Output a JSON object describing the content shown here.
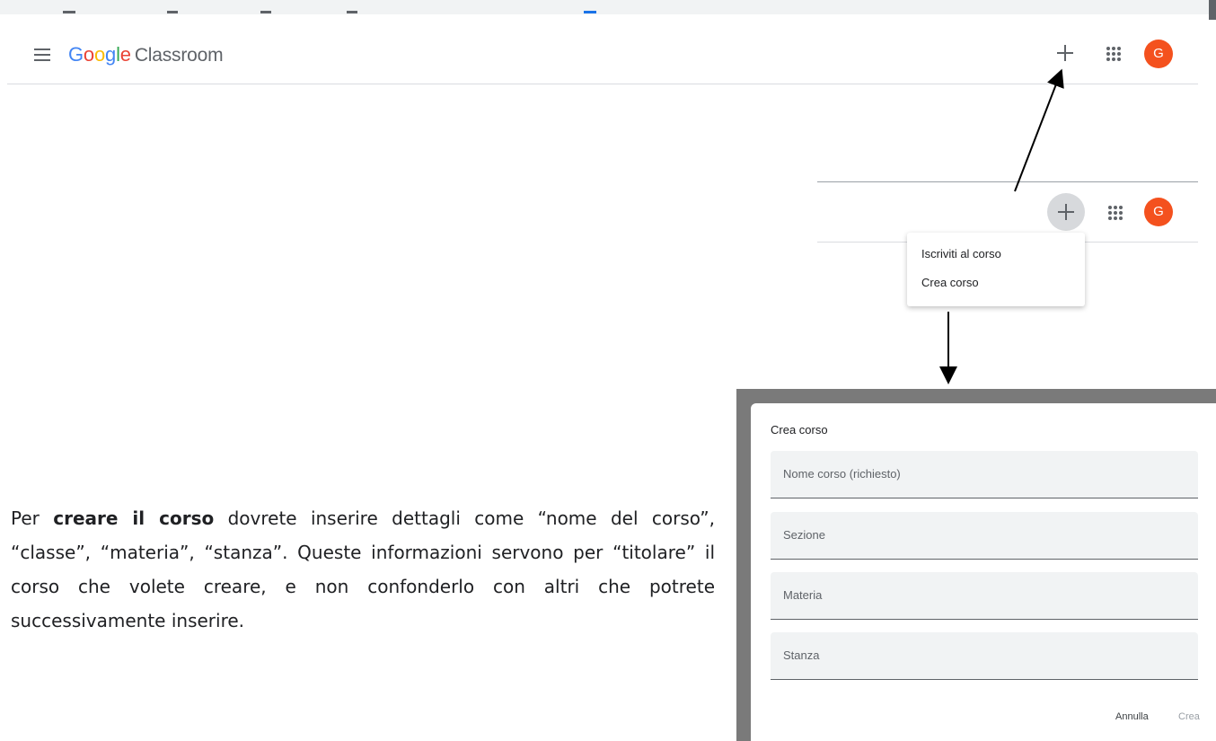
{
  "app": {
    "logo_word": "Google",
    "product_name": "Classroom"
  },
  "header": {
    "add_icon": "plus-icon",
    "apps_icon": "apps-grid-icon",
    "avatar_letter": "G",
    "avatar_color": "#f4511e"
  },
  "menu": {
    "items": [
      "Iscriviti al corso",
      "Crea corso"
    ]
  },
  "instructions": {
    "bold_phrase": "creare il corso",
    "prefix": "Per ",
    "rest": " dovrete inserire dettagli come “nome del corso”, “classe”, “materia”, “stanza”. Queste informazioni servono per “titolare” il corso che volete creare, e non confonderlo con altri che potrete successivamente inserire."
  },
  "dialog": {
    "title": "Crea corso",
    "fields": [
      {
        "placeholder": "Nome corso (richiesto)",
        "value": ""
      },
      {
        "placeholder": "Sezione",
        "value": ""
      },
      {
        "placeholder": "Materia",
        "value": ""
      },
      {
        "placeholder": "Stanza",
        "value": ""
      }
    ],
    "cancel_label": "Annulla",
    "create_label": "Crea"
  },
  "colors": {
    "accent_blue": "#1a73e8",
    "avatar": "#f4511e",
    "dialog_overlay": "#7a7a7a"
  }
}
